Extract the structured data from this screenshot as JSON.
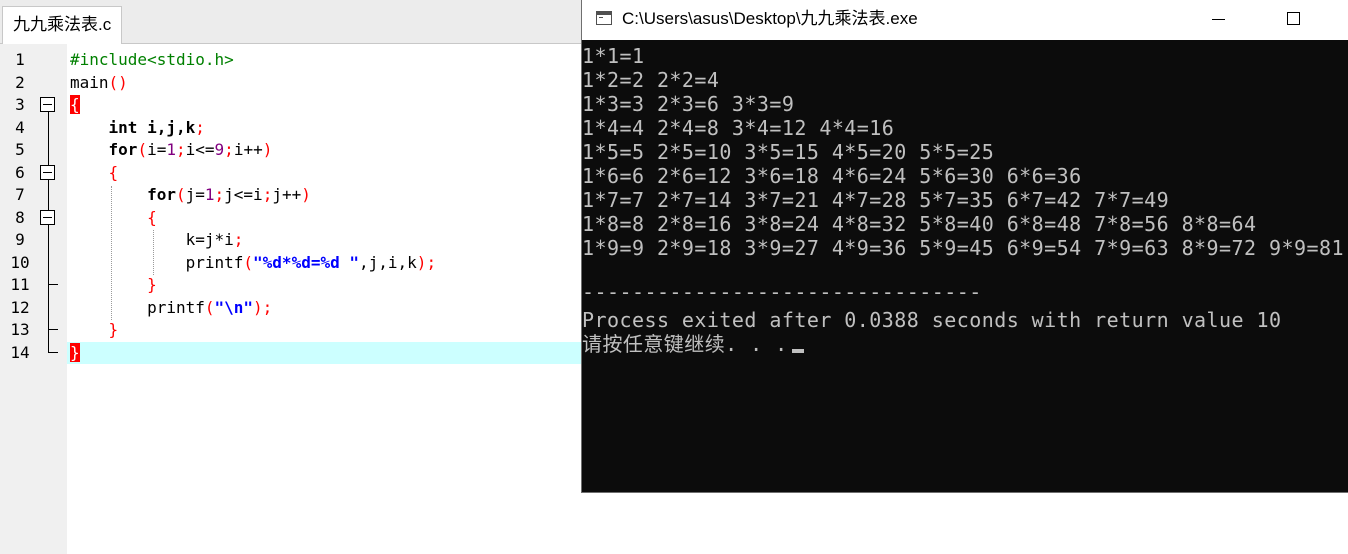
{
  "editor": {
    "tab_label": "九九乘法表.c",
    "line_numbers": [
      "1",
      "2",
      "3",
      "4",
      "5",
      "6",
      "7",
      "8",
      "9",
      "10",
      "11",
      "12",
      "13",
      "14"
    ],
    "code": {
      "l1": "#include<stdio.h>",
      "l2_name": "main",
      "l2_parens": "()",
      "brace_open": "{",
      "brace_close": "}",
      "kw_int": "int",
      "kw_for": "for",
      "decl_vars": " i,j,k",
      "semicolon": ";",
      "paren_open": "(",
      "paren_close": ")",
      "for1_a": "i=",
      "for1_b": "i<=",
      "for1_c": "i++",
      "for2_a": "j=",
      "for2_b": "j<=i",
      "for2_c": "j++",
      "num_1": "1",
      "num_9": "9",
      "assign": "k=j*i",
      "printf_name": "printf",
      "printf_fmt": "\"%d*%d=%d \"",
      "printf_args": ",j,i,k",
      "printf_nl": "\"\\n\""
    }
  },
  "console": {
    "title": "C:\\Users\\asus\\Desktop\\九九乘法表.exe",
    "lines": [
      "1*1=1",
      "1*2=2 2*2=4",
      "1*3=3 2*3=6 3*3=9",
      "1*4=4 2*4=8 3*4=12 4*4=16",
      "1*5=5 2*5=10 3*5=15 4*5=20 5*5=25",
      "1*6=6 2*6=12 3*6=18 4*6=24 5*6=30 6*6=36",
      "1*7=7 2*7=14 3*7=21 4*7=28 5*7=35 6*7=42 7*7=49",
      "1*8=8 2*8=16 3*8=24 4*8=32 5*8=40 6*8=48 7*8=56 8*8=64",
      "1*9=9 2*9=18 3*9=27 4*9=36 5*9=45 6*9=54 7*9=63 8*9=72 9*9=81"
    ],
    "separator": "--------------------------------",
    "exit_message": "Process exited after 0.0388 seconds with return value 10",
    "prompt": "请按任意键继续. . ."
  }
}
